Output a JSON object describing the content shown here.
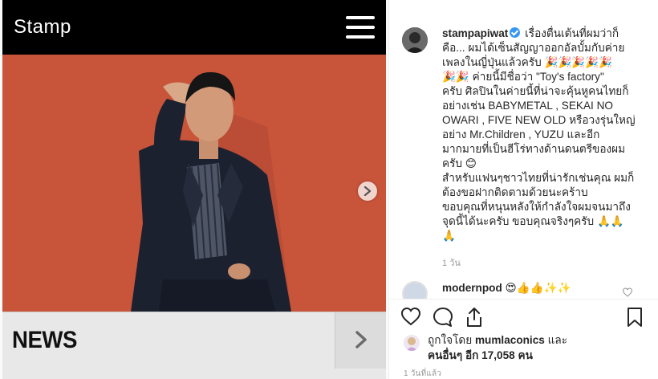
{
  "media": {
    "site_logo": "Stamp",
    "news_label": "NEWS"
  },
  "post": {
    "username": "stampapiwat",
    "caption_lines": [
      "เรื่องตื่นเต้นที่ผมว่าก็",
      "คือ... ผมได้เซ็นสัญญาออกอัลบั้มกับค่าย",
      "เพลงในญี่ปุ่นแล้วครับ 🎉🎉🎉🎉🎉",
      "🎉🎉 ค่ายนี้มีชื่อว่า \"Toy's factory\"",
      "ครับ ศิลปินในค่ายนี้ที่น่าจะคุ้นหูคนไทยก็",
      "อย่างเช่น BABYMETAL , SEKAI NO",
      "OWARI , FIVE NEW OLD หรือวงรุ่นใหญ่",
      "อย่าง Mr.Children , YUZU และอีก",
      "มากมายที่เป็นฮีโร่ทางด้านดนตรีของผม",
      "ครับ 😊",
      "สำหรับแฟนๆชาวไทยที่น่ารักเช่นคุณ ผมก็",
      "ต้องขอฝากติดตามด้วยนะคร้าบ",
      "ขอบคุณที่หนุนหลังให้กำลังใจผมจนมาถึง",
      "จุดนี้ได้นะครับ ขอบคุณจริงๆครับ 🙏🙏",
      "🙏"
    ],
    "caption_age": "1 วัน",
    "reply": {
      "username": "modernpod",
      "text": "😍👍👍✨✨"
    },
    "likes": {
      "prefix": "ถูกใจโดย",
      "liker": "mumlaconics",
      "and": "และ",
      "others_label": "คนอื่นๆ",
      "others_count_prefix": "อีก",
      "count": "17,058",
      "suffix": "คน"
    },
    "post_age": "1 วันที่แล้ว"
  },
  "colors": {
    "photo_background": "#c8543a",
    "verified_badge": "#3897f0",
    "site_header": "#000000",
    "news_bar": "#e8e8e8"
  },
  "icons": [
    "menu-icon",
    "chevron-right-icon",
    "verified-icon",
    "heart-icon",
    "comment-icon",
    "share-icon",
    "bookmark-icon"
  ]
}
